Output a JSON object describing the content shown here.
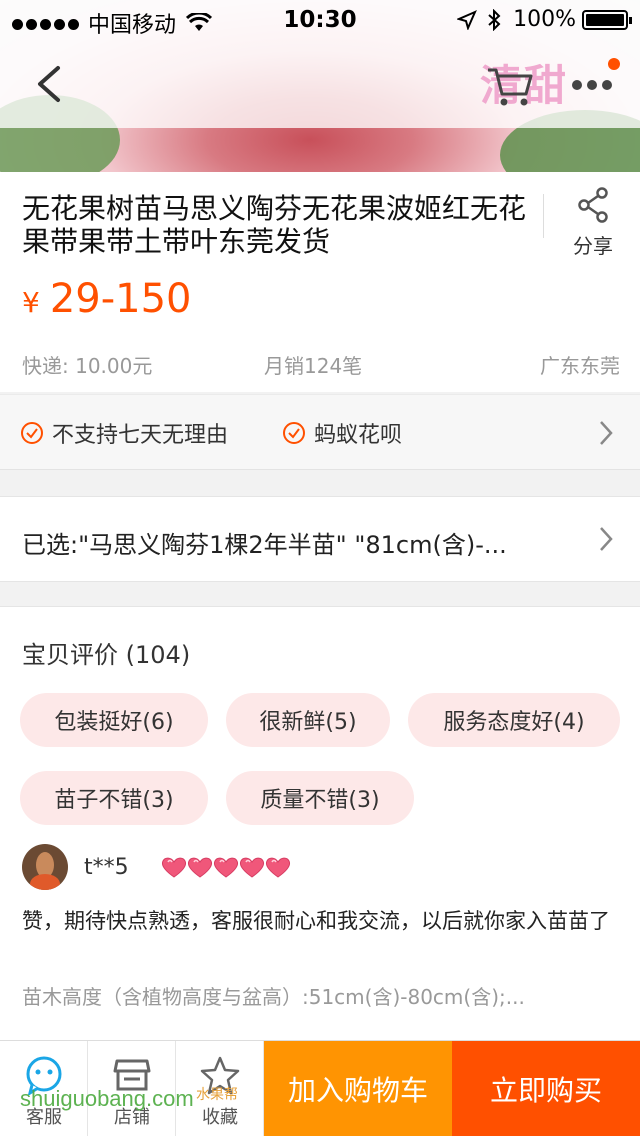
{
  "status_bar": {
    "carrier": "中国移动",
    "time": "10:30",
    "battery": "100%"
  },
  "hero": {
    "overlay_text": "清甜"
  },
  "nav": {
    "back_icon": "chevron-left-icon",
    "cart_icon": "cart-icon",
    "more_icon": "more-icon",
    "accent": "#ff5000"
  },
  "product": {
    "title": "无花果树苗马思义陶芬无花果波姬红无花果带果带土带叶东莞发货",
    "share_label": "分享",
    "currency": "¥",
    "price": "29-150",
    "shipping": "快递: 10.00元",
    "monthly_sales": "月销124笔",
    "location": "广东东莞"
  },
  "promotions": {
    "items": [
      "不支持七天无理由",
      "蚂蚁花呗"
    ]
  },
  "selection": {
    "text": "已选:\"马思义陶芬1棵2年半苗\" \"81cm(含)-..."
  },
  "reviews": {
    "title": "宝贝评价",
    "count": "(104)",
    "tags": [
      "包装挺好(6)",
      "很新鲜(5)",
      "服务态度好(4)",
      "苗子不错(3)",
      "质量不错(3)"
    ],
    "first": {
      "user": "t**5",
      "heart_count": 5,
      "text": "赞，期待快点熟透，客服很耐心和我交流，以后就你家入苗苗了",
      "sku": "苗木高度（含植物高度与盆高）:51cm(含)-80cm(含);..."
    }
  },
  "bottom_bar": {
    "service": "客服",
    "shop": "店铺",
    "favorite": "收藏",
    "add_to_cart": "加入购物车",
    "buy_now": "立即购买",
    "cart_color": "#ff9402",
    "buy_color": "#ff5000"
  },
  "watermark": {
    "text": "shuiguobang.com",
    "text2": "水果帮"
  }
}
